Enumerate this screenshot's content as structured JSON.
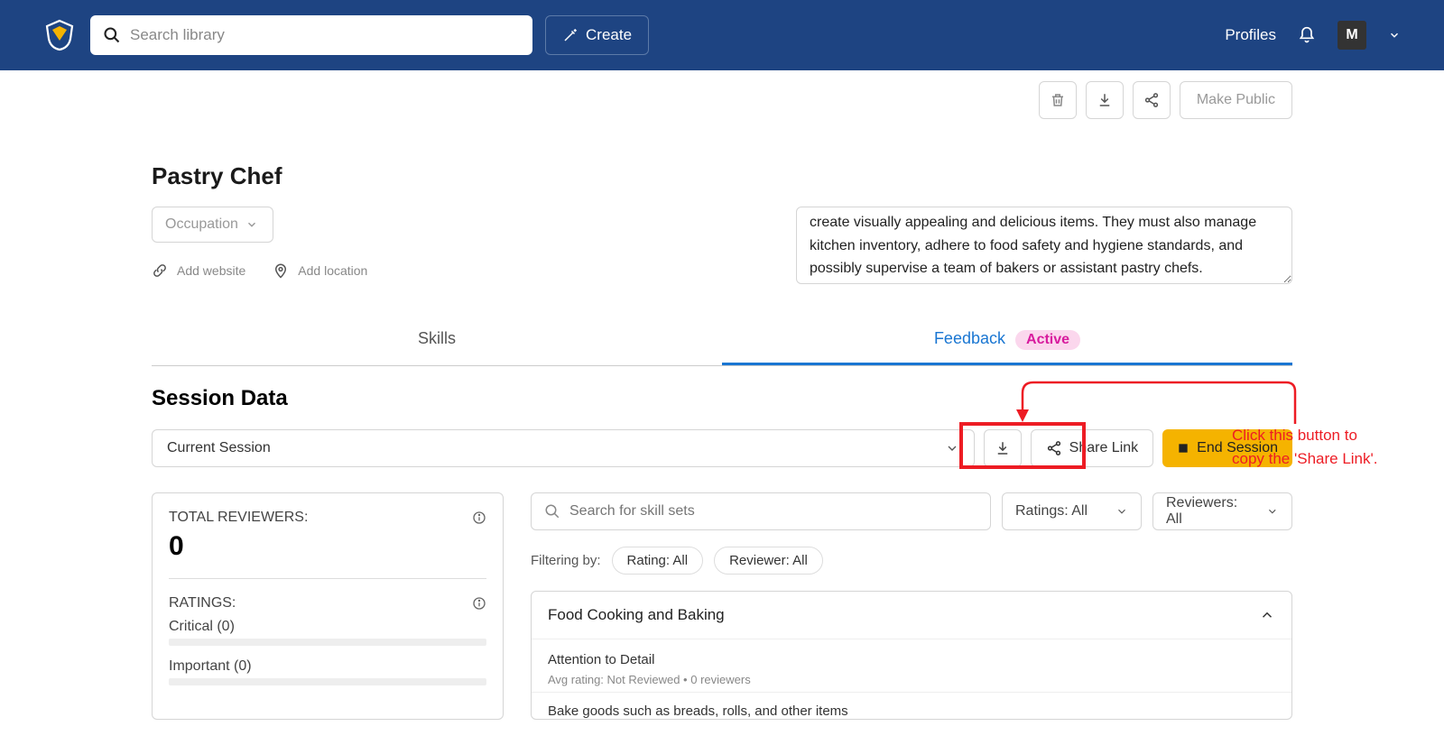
{
  "header": {
    "search_placeholder": "Search library",
    "create_label": "Create",
    "profiles_label": "Profiles",
    "avatar_letter": "M"
  },
  "actions": {
    "make_public": "Make Public"
  },
  "profile": {
    "title": "Pastry Chef",
    "occupation_label": "Occupation",
    "add_website": "Add website",
    "add_location": "Add location",
    "description": "create visually appealing and delicious items. They must also manage kitchen inventory, adhere to food safety and hygiene standards, and possibly supervise a team of bakers or assistant pastry chefs."
  },
  "tabs": {
    "skills": "Skills",
    "feedback": "Feedback",
    "badge": "Active"
  },
  "session": {
    "section_title": "Session Data",
    "current": "Current Session",
    "share_link": "Share Link",
    "end_session": "End Session"
  },
  "stats": {
    "total_reviewers_label": "TOTAL REVIEWERS:",
    "total_reviewers_value": "0",
    "ratings_label": "RATINGS:",
    "critical_label": "Critical (0)",
    "important_label": "Important (0)"
  },
  "filters": {
    "search_placeholder": "Search for skill sets",
    "ratings_all": "Ratings: All",
    "reviewers_all": "Reviewers: All",
    "filtering_by": "Filtering by:",
    "chip_rating": "Rating: All",
    "chip_reviewer": "Reviewer: All"
  },
  "skill_card": {
    "title": "Food Cooking and Baking",
    "item_title": "Attention to Detail",
    "item_meta": "Avg rating: Not Reviewed   •   0 reviewers",
    "item2_title": "Bake goods such as breads, rolls, and other items"
  },
  "annotation": {
    "text": "Click this button to copy the 'Share Link'."
  }
}
